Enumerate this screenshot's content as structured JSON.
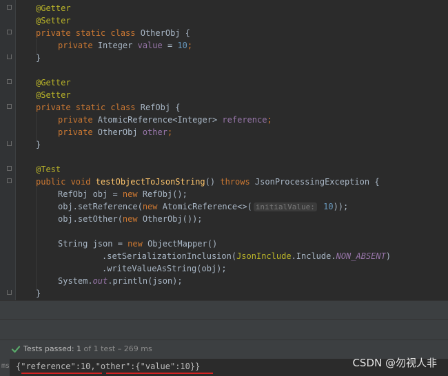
{
  "code_lines": [
    [
      "@Getter"
    ],
    [
      "@Setter"
    ],
    [
      "private static class ",
      "OtherObj",
      " {"
    ],
    [
      "private ",
      "Integer ",
      "value",
      " = ",
      "10",
      ";"
    ],
    [
      "}"
    ],
    [
      ""
    ],
    [
      "@Getter"
    ],
    [
      "@Setter"
    ],
    [
      "private static class ",
      "RefObj",
      " {"
    ],
    [
      "private ",
      "AtomicReference<Integer> ",
      "reference",
      ";"
    ],
    [
      "private ",
      "OtherObj ",
      "other",
      ";"
    ],
    [
      "}"
    ],
    [
      ""
    ],
    [
      "@Test"
    ],
    [
      "public void ",
      "testObjectToJsonString",
      "() ",
      "throws ",
      "JsonProcessingException {"
    ],
    [
      "RefObj obj = ",
      "new ",
      "RefObj();"
    ],
    [
      "obj.setReference(",
      "new ",
      "AtomicReference<>(",
      "initialValue:",
      " 10",
      "));"
    ],
    [
      "obj.setOther(",
      "new ",
      "OtherObj());"
    ],
    [
      ""
    ],
    [
      "String json = ",
      "new ",
      "ObjectMapper()"
    ],
    [
      ".setSerializationInclusion(",
      "JsonInclude",
      ".Include.",
      "NON_ABSENT",
      ")"
    ],
    [
      ".writeValueAsString(obj);"
    ],
    [
      "System.",
      "out",
      ".println(json);"
    ],
    [
      "}"
    ]
  ],
  "status": {
    "passed_label": "Tests passed:",
    "count_label": "1",
    "of_label": "of 1 test",
    "time_label": "– 269 ms"
  },
  "output": {
    "left_label": "ms",
    "json_text": "{\"reference\":10,\"other\":{\"value\":10}}"
  },
  "watermark": "CSDN @勿视人非",
  "colors": {
    "background": "#2b2b2b",
    "keyword": "#cc7832",
    "annotation": "#bbb529",
    "field": "#9876aa",
    "number": "#6897bb",
    "method": "#ffc66d",
    "underline": "#d62222",
    "check": "#59a869"
  }
}
